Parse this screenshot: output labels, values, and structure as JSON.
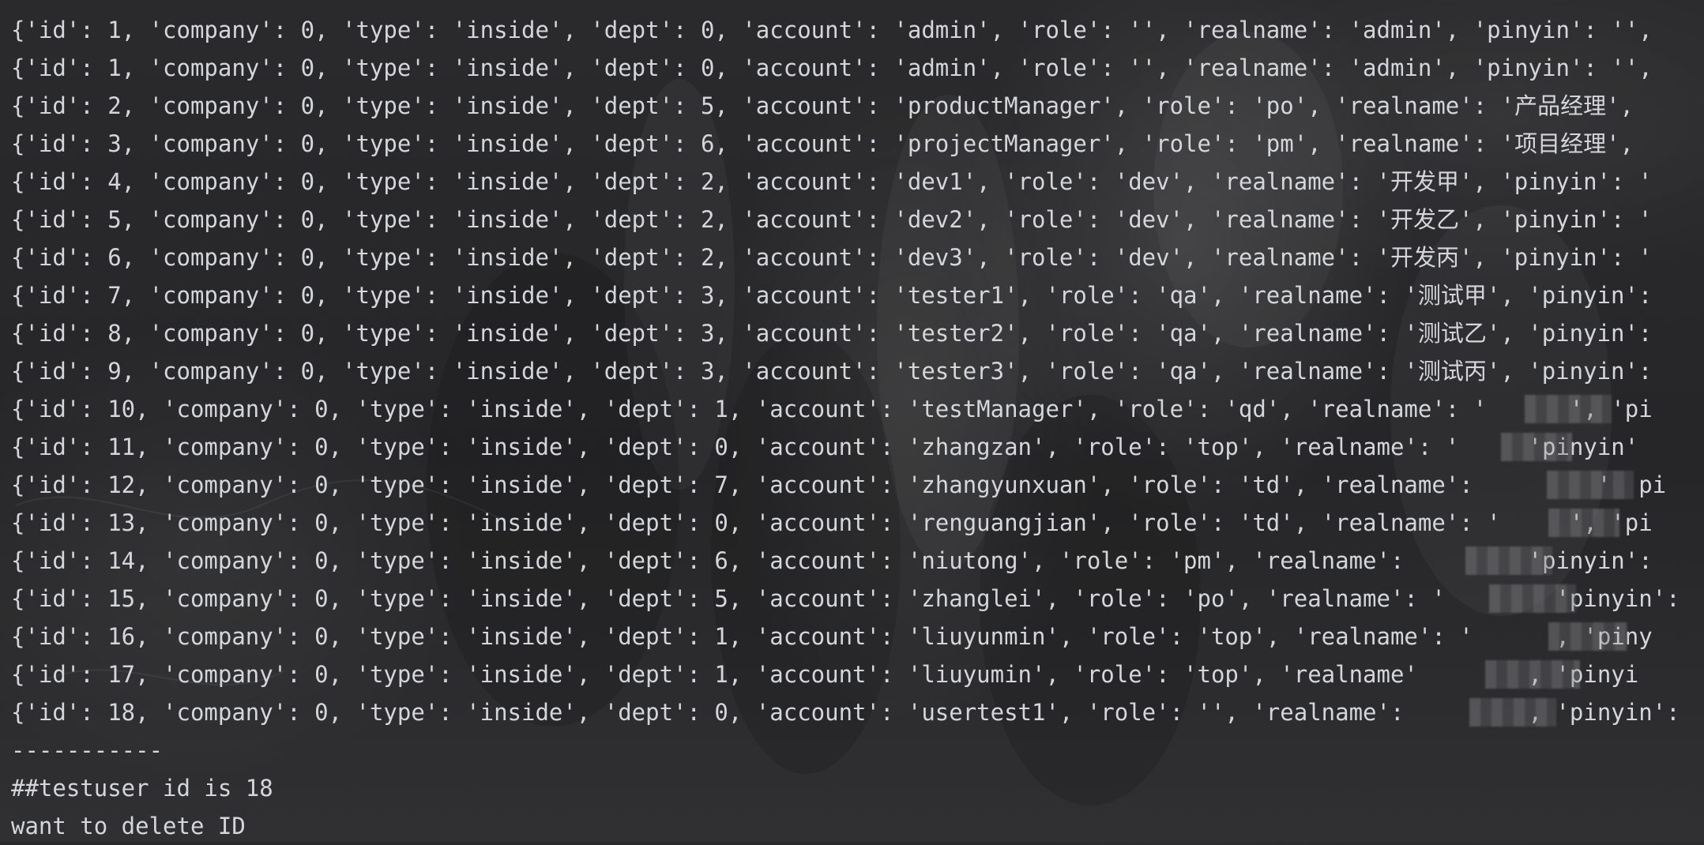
{
  "console": {
    "lines": [
      "{'id': 1, 'company': 0, 'type': 'inside', 'dept': 0, 'account': 'admin', 'role': '', 'realname': 'admin', 'pinyin': '',",
      "{'id': 1, 'company': 0, 'type': 'inside', 'dept': 0, 'account': 'admin', 'role': '', 'realname': 'admin', 'pinyin': '',",
      "{'id': 2, 'company': 0, 'type': 'inside', 'dept': 5, 'account': 'productManager', 'role': 'po', 'realname': '产品经理',",
      "{'id': 3, 'company': 0, 'type': 'inside', 'dept': 6, 'account': 'projectManager', 'role': 'pm', 'realname': '项目经理',",
      "{'id': 4, 'company': 0, 'type': 'inside', 'dept': 2, 'account': 'dev1', 'role': 'dev', 'realname': '开发甲', 'pinyin': '",
      "{'id': 5, 'company': 0, 'type': 'inside', 'dept': 2, 'account': 'dev2', 'role': 'dev', 'realname': '开发乙', 'pinyin': '",
      "{'id': 6, 'company': 0, 'type': 'inside', 'dept': 2, 'account': 'dev3', 'role': 'dev', 'realname': '开发丙', 'pinyin': '",
      "{'id': 7, 'company': 0, 'type': 'inside', 'dept': 3, 'account': 'tester1', 'role': 'qa', 'realname': '测试甲', 'pinyin':",
      "{'id': 8, 'company': 0, 'type': 'inside', 'dept': 3, 'account': 'tester2', 'role': 'qa', 'realname': '测试乙', 'pinyin':",
      "{'id': 9, 'company': 0, 'type': 'inside', 'dept': 3, 'account': 'tester3', 'role': 'qa', 'realname': '测试丙', 'pinyin':",
      "{'id': 10, 'company': 0, 'type': 'inside', 'dept': 1, 'account': 'testManager', 'role': 'qd', 'realname': '      ', 'pi",
      "{'id': 11, 'company': 0, 'type': 'inside', 'dept': 0, 'account': 'zhangzan', 'role': 'top', 'realname': '     'pinyin'",
      "{'id': 12, 'company': 0, 'type': 'inside', 'dept': 7, 'account': 'zhangyunxuan', 'role': 'td', 'realname':         '  pi",
      "{'id': 13, 'company': 0, 'type': 'inside', 'dept': 0, 'account': 'renguangjian', 'role': 'td', 'realname': '     ', 'pi",
      "{'id': 14, 'company': 0, 'type': 'inside', 'dept': 6, 'account': 'niutong', 'role': 'pm', 'realname':         'pinyin':",
      "{'id': 15, 'company': 0, 'type': 'inside', 'dept': 5, 'account': 'zhanglei', 'role': 'po', 'realname': '        'pinyin':",
      "{'id': 16, 'company': 0, 'type': 'inside', 'dept': 1, 'account': 'liuyunmin', 'role': 'top', 'realname': '      , 'piny",
      "{'id': 17, 'company': 0, 'type': 'inside', 'dept': 1, 'account': 'liuyumin', 'role': 'top', 'realname'        , 'pinyi",
      "{'id': 18, 'company': 0, 'type': 'inside', 'dept': 0, 'account': 'usertest1', 'role': '', 'realname':         , 'pinyin':",
      "-----------",
      "##testuser id is 18",
      "want to delete ID"
    ]
  }
}
